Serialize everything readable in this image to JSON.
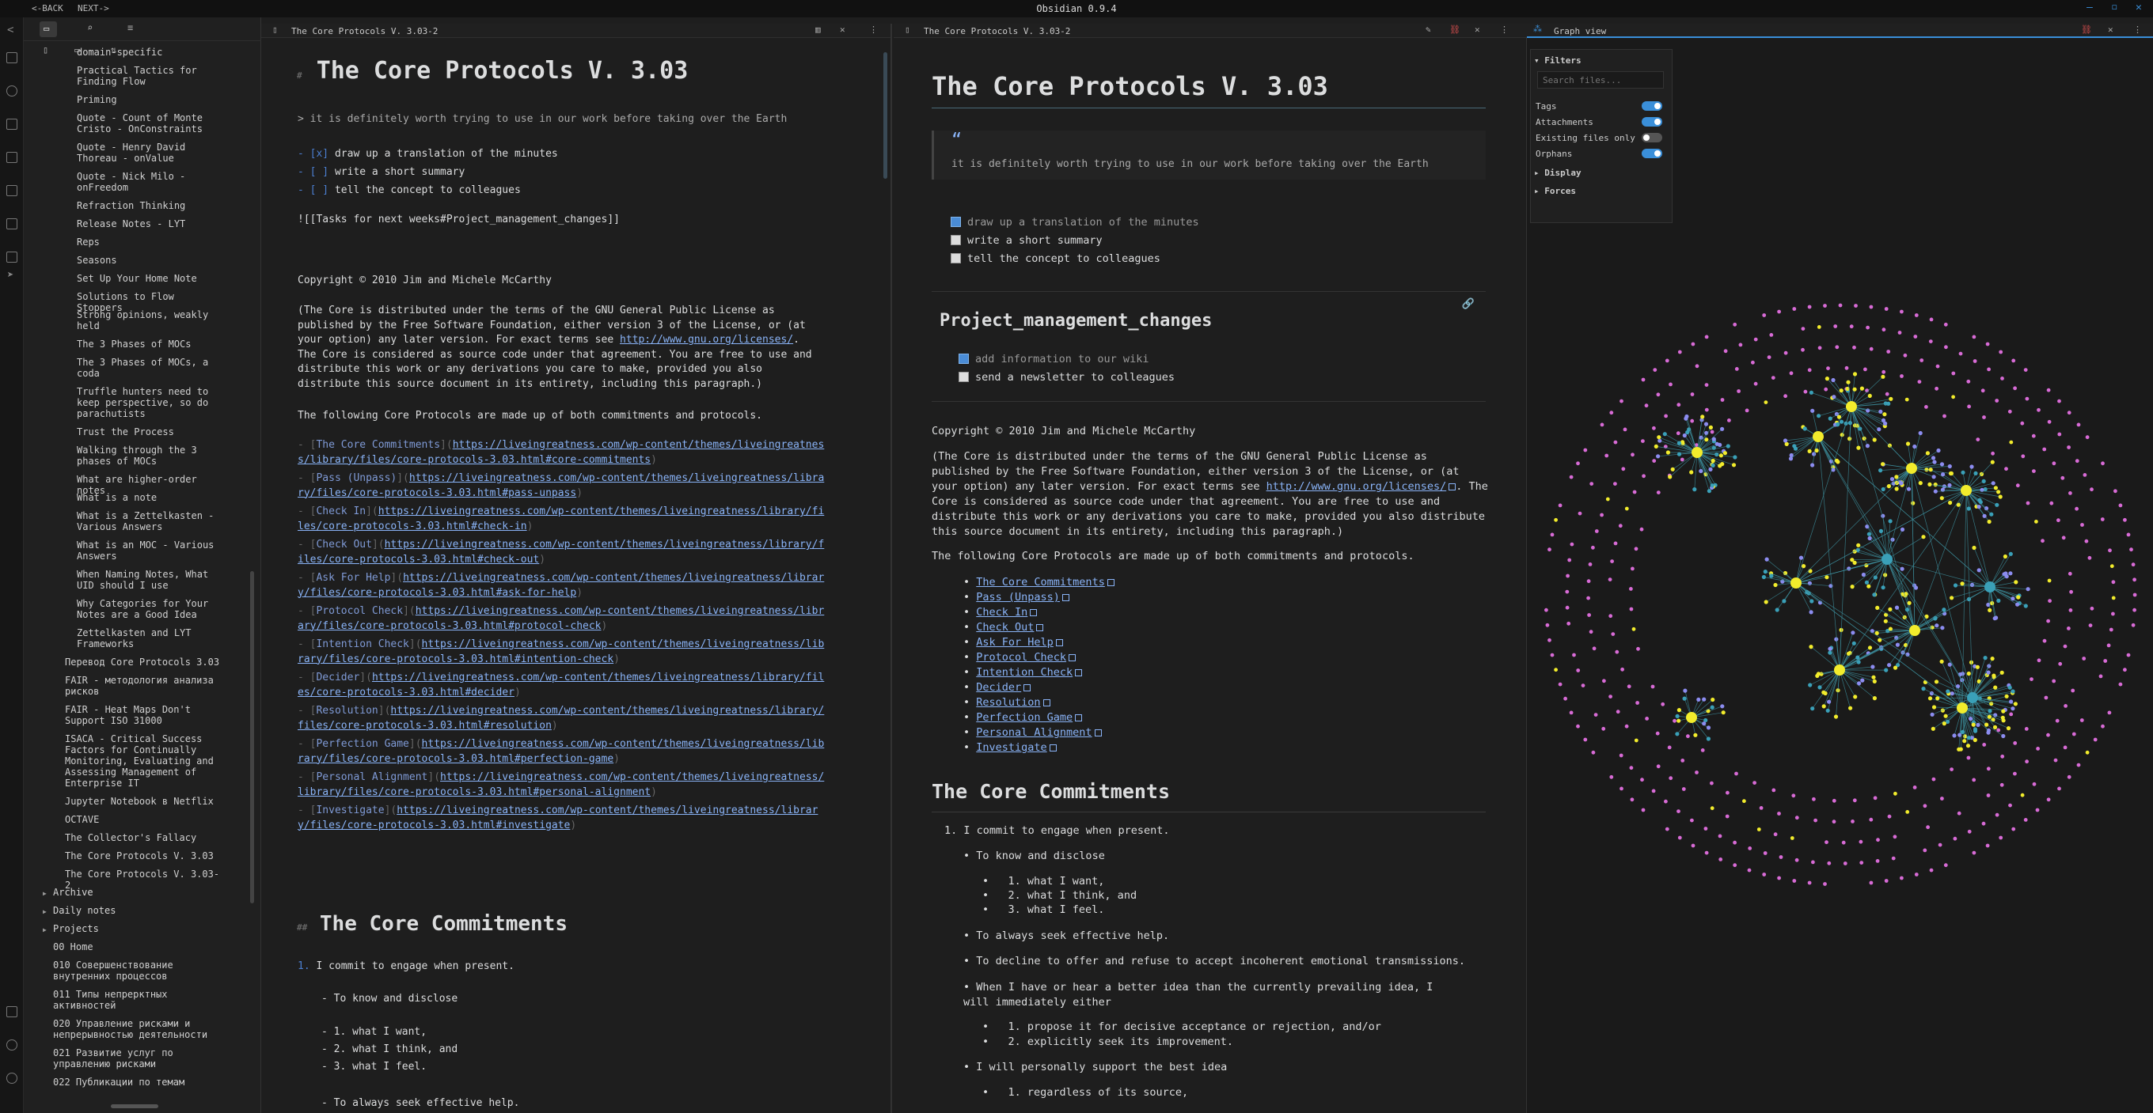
{
  "app": {
    "title": "Obsidian 0.9.4",
    "back": "BACK",
    "next": "NEXT"
  },
  "sidebar": {
    "items": [
      {
        "label": "domain-specific",
        "type": "file"
      },
      {
        "label": "Practical Tactics for Finding Flow",
        "type": "file"
      },
      {
        "label": "Priming",
        "type": "file"
      },
      {
        "label": "Quote - Count of Monte Cristo - OnConstraints",
        "type": "file"
      },
      {
        "label": "Quote - Henry David Thoreau - onValue",
        "type": "file"
      },
      {
        "label": "Quote - Nick Milo - onFreedom",
        "type": "file"
      },
      {
        "label": "Refraction Thinking",
        "type": "file"
      },
      {
        "label": "Release Notes - LYT",
        "type": "file"
      },
      {
        "label": "Reps",
        "type": "file"
      },
      {
        "label": "Seasons",
        "type": "file"
      },
      {
        "label": "Set Up Your Home Note",
        "type": "file"
      },
      {
        "label": "Solutions to Flow Stoppers",
        "type": "file"
      },
      {
        "label": "Strong opinions, weakly held",
        "type": "file"
      },
      {
        "label": "The 3 Phases of MOCs",
        "type": "file"
      },
      {
        "label": "The 3 Phases of MOCs, a coda",
        "type": "file"
      },
      {
        "label": "Truffle hunters need to keep perspective, so do parachutists",
        "type": "file"
      },
      {
        "label": "Trust the Process",
        "type": "file"
      },
      {
        "label": "Walking through the 3 phases of MOCs",
        "type": "file"
      },
      {
        "label": "What are higher-order notes",
        "type": "file"
      },
      {
        "label": "What is a note",
        "type": "file"
      },
      {
        "label": "What is a Zettelkasten - Various Answers",
        "type": "file"
      },
      {
        "label": "What is an MOC - Various Answers",
        "type": "file"
      },
      {
        "label": "When Naming Notes, What UID should I use",
        "type": "file"
      },
      {
        "label": "Why Categories for Your Notes are a Good Idea",
        "type": "file"
      },
      {
        "label": "Zettelkasten and LYT Frameworks",
        "type": "file"
      },
      {
        "label": "Перевод Core Protocols 3.03",
        "type": "file"
      },
      {
        "label": "FAIR - методология анализа рисков",
        "type": "file"
      },
      {
        "label": "FAIR - Heat Maps Don't Support ISO 31000",
        "type": "file"
      },
      {
        "label": "ISACA - Critical Success Factors for Continually Monitoring, Evaluating and Assessing Management of Enterprise IT",
        "type": "file"
      },
      {
        "label": "Jupyter Notebook в Netflix",
        "type": "file"
      },
      {
        "label": "OCTAVE",
        "type": "file"
      },
      {
        "label": "The Collector's Fallacy",
        "type": "file"
      },
      {
        "label": "The Core Protocols V. 3.03",
        "type": "file"
      },
      {
        "label": "The Core Protocols V. 3.03-2",
        "type": "file"
      },
      {
        "label": "Archive",
        "type": "folder"
      },
      {
        "label": "Daily notes",
        "type": "folder"
      },
      {
        "label": "Projects",
        "type": "folder"
      },
      {
        "label": "00 Home",
        "type": "file"
      },
      {
        "label": "010 Совершенствование внутренних процессов",
        "type": "file"
      },
      {
        "label": "011 Типы непрерктных активностей",
        "type": "file"
      },
      {
        "label": "020 Управление рисками и непрерывностью деятельности",
        "type": "file"
      },
      {
        "label": "021 Развитие услуг по управлению рисками",
        "type": "file"
      },
      {
        "label": "022 Публикации по темам",
        "type": "file"
      }
    ]
  },
  "editor": {
    "tab_title": "The Core Protocols V. 3.03-2",
    "h1_mark": "#",
    "h1": "The Core Protocols V. 3.03",
    "quote": "> it is definitely worth trying to use in our work before taking over the Earth",
    "tasks": [
      {
        "mark": "- [x]",
        "text": "draw up a translation of the minutes"
      },
      {
        "mark": "- [ ]",
        "text": "write a short summary"
      },
      {
        "mark": "- [ ]",
        "text": "tell the concept to colleagues"
      }
    ],
    "embed": "![[Tasks for next weeks#Project_management_changes]]",
    "copyright": "Copyright © 2010 Jim and Michele McCarthy",
    "license_pre": "(The Core is distributed under the terms of the GNU General Public License as published by the Free Software Foundation, either version 3 of the License, or (at your option) any later version. For exact terms see ",
    "license_url": "http://www.gnu.org/licenses/",
    "license_post": ". The Core is considered as source code under that agreement. You are free to use and distribute this work or any derivations you care to make, provided you also distribute this source document in its entirety, including this paragraph.)",
    "intro": "The following Core Protocols are made up of both commitments and protocols.",
    "links": [
      {
        "text": "The Core Commitments",
        "url": "https://liveingreatness.com/wp-content/themes/liveingreatness/library/files/core-protocols-3.03.html#core-commitments"
      },
      {
        "text": "Pass (Unpass)",
        "url": "https://liveingreatness.com/wp-content/themes/liveingreatness/library/files/core-protocols-3.03.html#pass-unpass"
      },
      {
        "text": "Check In",
        "url": "https://liveingreatness.com/wp-content/themes/liveingreatness/library/files/core-protocols-3.03.html#check-in"
      },
      {
        "text": "Check Out",
        "url": "https://liveingreatness.com/wp-content/themes/liveingreatness/library/files/core-protocols-3.03.html#check-out"
      },
      {
        "text": "Ask For Help",
        "url": "https://liveingreatness.com/wp-content/themes/liveingreatness/library/files/core-protocols-3.03.html#ask-for-help"
      },
      {
        "text": "Protocol Check",
        "url": "https://liveingreatness.com/wp-content/themes/liveingreatness/library/files/core-protocols-3.03.html#protocol-check"
      },
      {
        "text": "Intention Check",
        "url": "https://liveingreatness.com/wp-content/themes/liveingreatness/library/files/core-protocols-3.03.html#intention-check"
      },
      {
        "text": "Decider",
        "url": "https://liveingreatness.com/wp-content/themes/liveingreatness/library/files/core-protocols-3.03.html#decider"
      },
      {
        "text": "Resolution",
        "url": "https://liveingreatness.com/wp-content/themes/liveingreatness/library/files/core-protocols-3.03.html#resolution"
      },
      {
        "text": "Perfection Game",
        "url": "https://liveingreatness.com/wp-content/themes/liveingreatness/library/files/core-protocols-3.03.html#perfection-game"
      },
      {
        "text": "Personal Alignment",
        "url": "https://liveingreatness.com/wp-content/themes/liveingreatness/library/files/core-protocols-3.03.html#personal-alignment"
      },
      {
        "text": "Investigate",
        "url": "https://liveingreatness.com/wp-content/themes/liveingreatness/library/files/core-protocols-3.03.html#investigate"
      }
    ],
    "h2_mark": "##",
    "h2": "The Core Commitments",
    "c1_mark": "1.",
    "c1": "I commit to engage when present.",
    "c1a": "- To know and disclose",
    "c1a_items": [
      "- 1. what I want,",
      "- 2. what I think, and",
      "- 3. what I feel."
    ],
    "c1b": "- To always seek effective help."
  },
  "preview": {
    "tab_title": "The Core Protocols V. 3.03-2",
    "h1": "The Core Protocols V. 3.03",
    "quote_mark": "“",
    "quote": "it is definitely worth trying to use in our work before taking over the Earth",
    "tasks": [
      {
        "text": "draw up a translation of the minutes",
        "done": true
      },
      {
        "text": "write a short summary",
        "done": false
      },
      {
        "text": "tell the concept to colleagues",
        "done": false
      }
    ],
    "embed_h2": "Project_management_changes",
    "embed_tasks": [
      {
        "text": "add information to our wiki",
        "done": true
      },
      {
        "text": "send a newsletter to colleagues",
        "done": false
      }
    ],
    "copyright": "Copyright © 2010 Jim and Michele McCarthy",
    "license_pre": "(The Core is distributed under the terms of the GNU General Public License as published by the Free Software Foundation, either version 3 of the License, or (at your option) any later version. For exact terms see ",
    "license_url": "http://www.gnu.org/licenses/",
    "license_post": ". The Core is considered as source code under that agreement. You are free to use and distribute this work or any derivations you care to make, provided you also distribute this source document in its entirety, including this paragraph.)",
    "intro": "The following Core Protocols are made up of both commitments and protocols.",
    "links": [
      "The Core Commitments",
      "Pass (Unpass)",
      "Check In",
      "Check Out",
      "Ask For Help",
      "Protocol Check",
      "Intention Check",
      "Decider",
      "Resolution",
      "Perfection Game",
      "Personal Alignment",
      "Investigate"
    ],
    "h2": "The Core Commitments",
    "c1": "1. I commit to engage when present.",
    "c1a": "To know and disclose",
    "c1a_items": [
      "1. what I want,",
      "2. what I think, and",
      "3. what I feel."
    ],
    "c1b": "To always seek effective help.",
    "c1c": "To decline to offer and refuse to accept incoherent emotional transmissions.",
    "c1d": "When I have or hear a better idea than the currently prevailing idea, I will immediately either",
    "c1d_items": [
      "1. propose it for decisive acceptance or rejection, and/or",
      "2. explicitly seek its improvement."
    ],
    "c1e": "I will personally support the best idea",
    "c1e_items": [
      "1. regardless of its source,"
    ]
  },
  "graph": {
    "tab_title": "Graph view",
    "filters_label": "Filters",
    "search_placeholder": "Search files...",
    "toggles": [
      {
        "label": "Tags",
        "on": true
      },
      {
        "label": "Attachments",
        "on": true
      },
      {
        "label": "Existing files only",
        "on": false
      },
      {
        "label": "Orphans",
        "on": true
      }
    ],
    "display_label": "Display",
    "forces_label": "Forces",
    "colors": {
      "orphan": "#d86bd6",
      "tag": "#f2ec2c",
      "note": "#8c8cf0",
      "hub": "#3aa0b8",
      "link": "#3c8e9c"
    }
  }
}
